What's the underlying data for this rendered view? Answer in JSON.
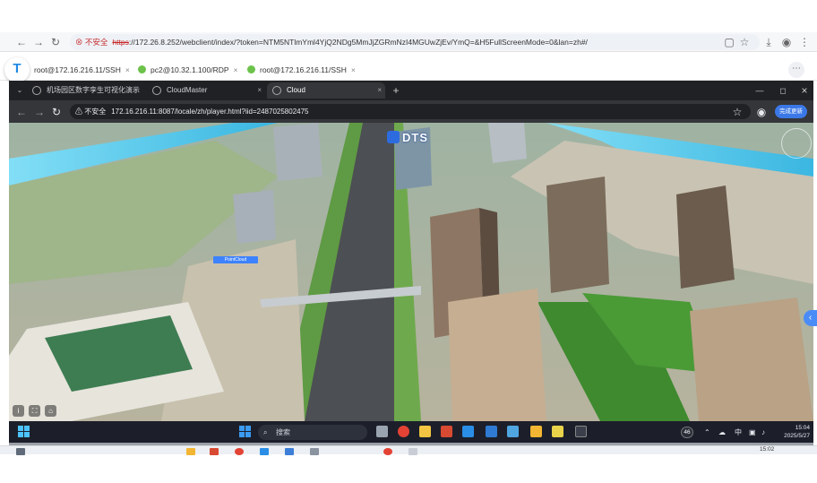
{
  "outer_browser": {
    "not_secure": "不安全",
    "url_scheme": "https",
    "url_rest": "://172.26.8.252/webclient/index/?token=NTM5NTlmYml4YjQ2NDg5MmJjZGRmNzI4MGUwZjEv/YmQ=&H5FullScreenMode=0&lan=zh#/"
  },
  "remote_tabs": [
    {
      "label": "root@172.16.216.11/SSH",
      "dot_color": "#6cc24a"
    },
    {
      "label": "pc2@10.32.1.100/RDP",
      "dot_color": "#6cc24a"
    },
    {
      "label": "root@172.16.216.11/SSH",
      "dot_color": "#6cc24a"
    }
  ],
  "inner_browser": {
    "tabs": [
      {
        "label": "机场园区数字孪生可视化演示"
      },
      {
        "label": "CloudMaster"
      },
      {
        "label": "Cloud"
      }
    ],
    "active_tab_index": 2,
    "not_secure": "不安全",
    "url": "172.16.216.11:8087/locale/zh/player.html?iid=2487025802475",
    "ext_label": "完成更新"
  },
  "viewport": {
    "logo_text": "DTS",
    "label_tag": "PointCloud",
    "tools": [
      "i",
      "⛶",
      "⌂"
    ]
  },
  "remote_taskbar": {
    "search_placeholder": "搜索",
    "tray_badge": "46",
    "ime": "中",
    "time": "15:04",
    "date": "2025/5/27"
  },
  "local_taskbar": {
    "time": "15:02"
  },
  "colors": {
    "inner_chrome": "#35363a",
    "accent": "#3d82ff",
    "taskbar": "#1c1f2a"
  }
}
